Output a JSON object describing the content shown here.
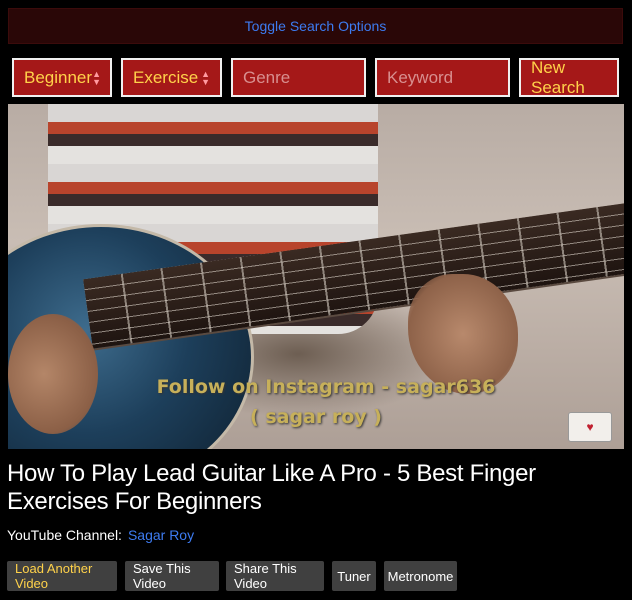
{
  "search_toggle": {
    "label": "Toggle Search Options"
  },
  "search": {
    "level": "Beginner",
    "category": "Exercise",
    "genre_placeholder": "Genre",
    "keyword_placeholder": "Keyword",
    "new_search_label": "New Search"
  },
  "video": {
    "overlay_line1": "Follow on Instagram - sagar636",
    "overlay_line2": "( sagar roy )",
    "title": "How To Play Lead Guitar Like A Pro - 5 Best Finger Exercises For Beginners",
    "channel_label": "YouTube Channel:",
    "channel_name": "Sagar Roy"
  },
  "actions": {
    "load_another": "Load Another Video",
    "save": "Save This Video",
    "share": "Share This Video",
    "tuner": "Tuner",
    "metronome": "Metronome"
  },
  "colors": {
    "accent_yellow": "#ffd24a",
    "control_red": "#a51818",
    "link_blue": "#3d7bf0",
    "toggle_bg": "#2a0707"
  }
}
